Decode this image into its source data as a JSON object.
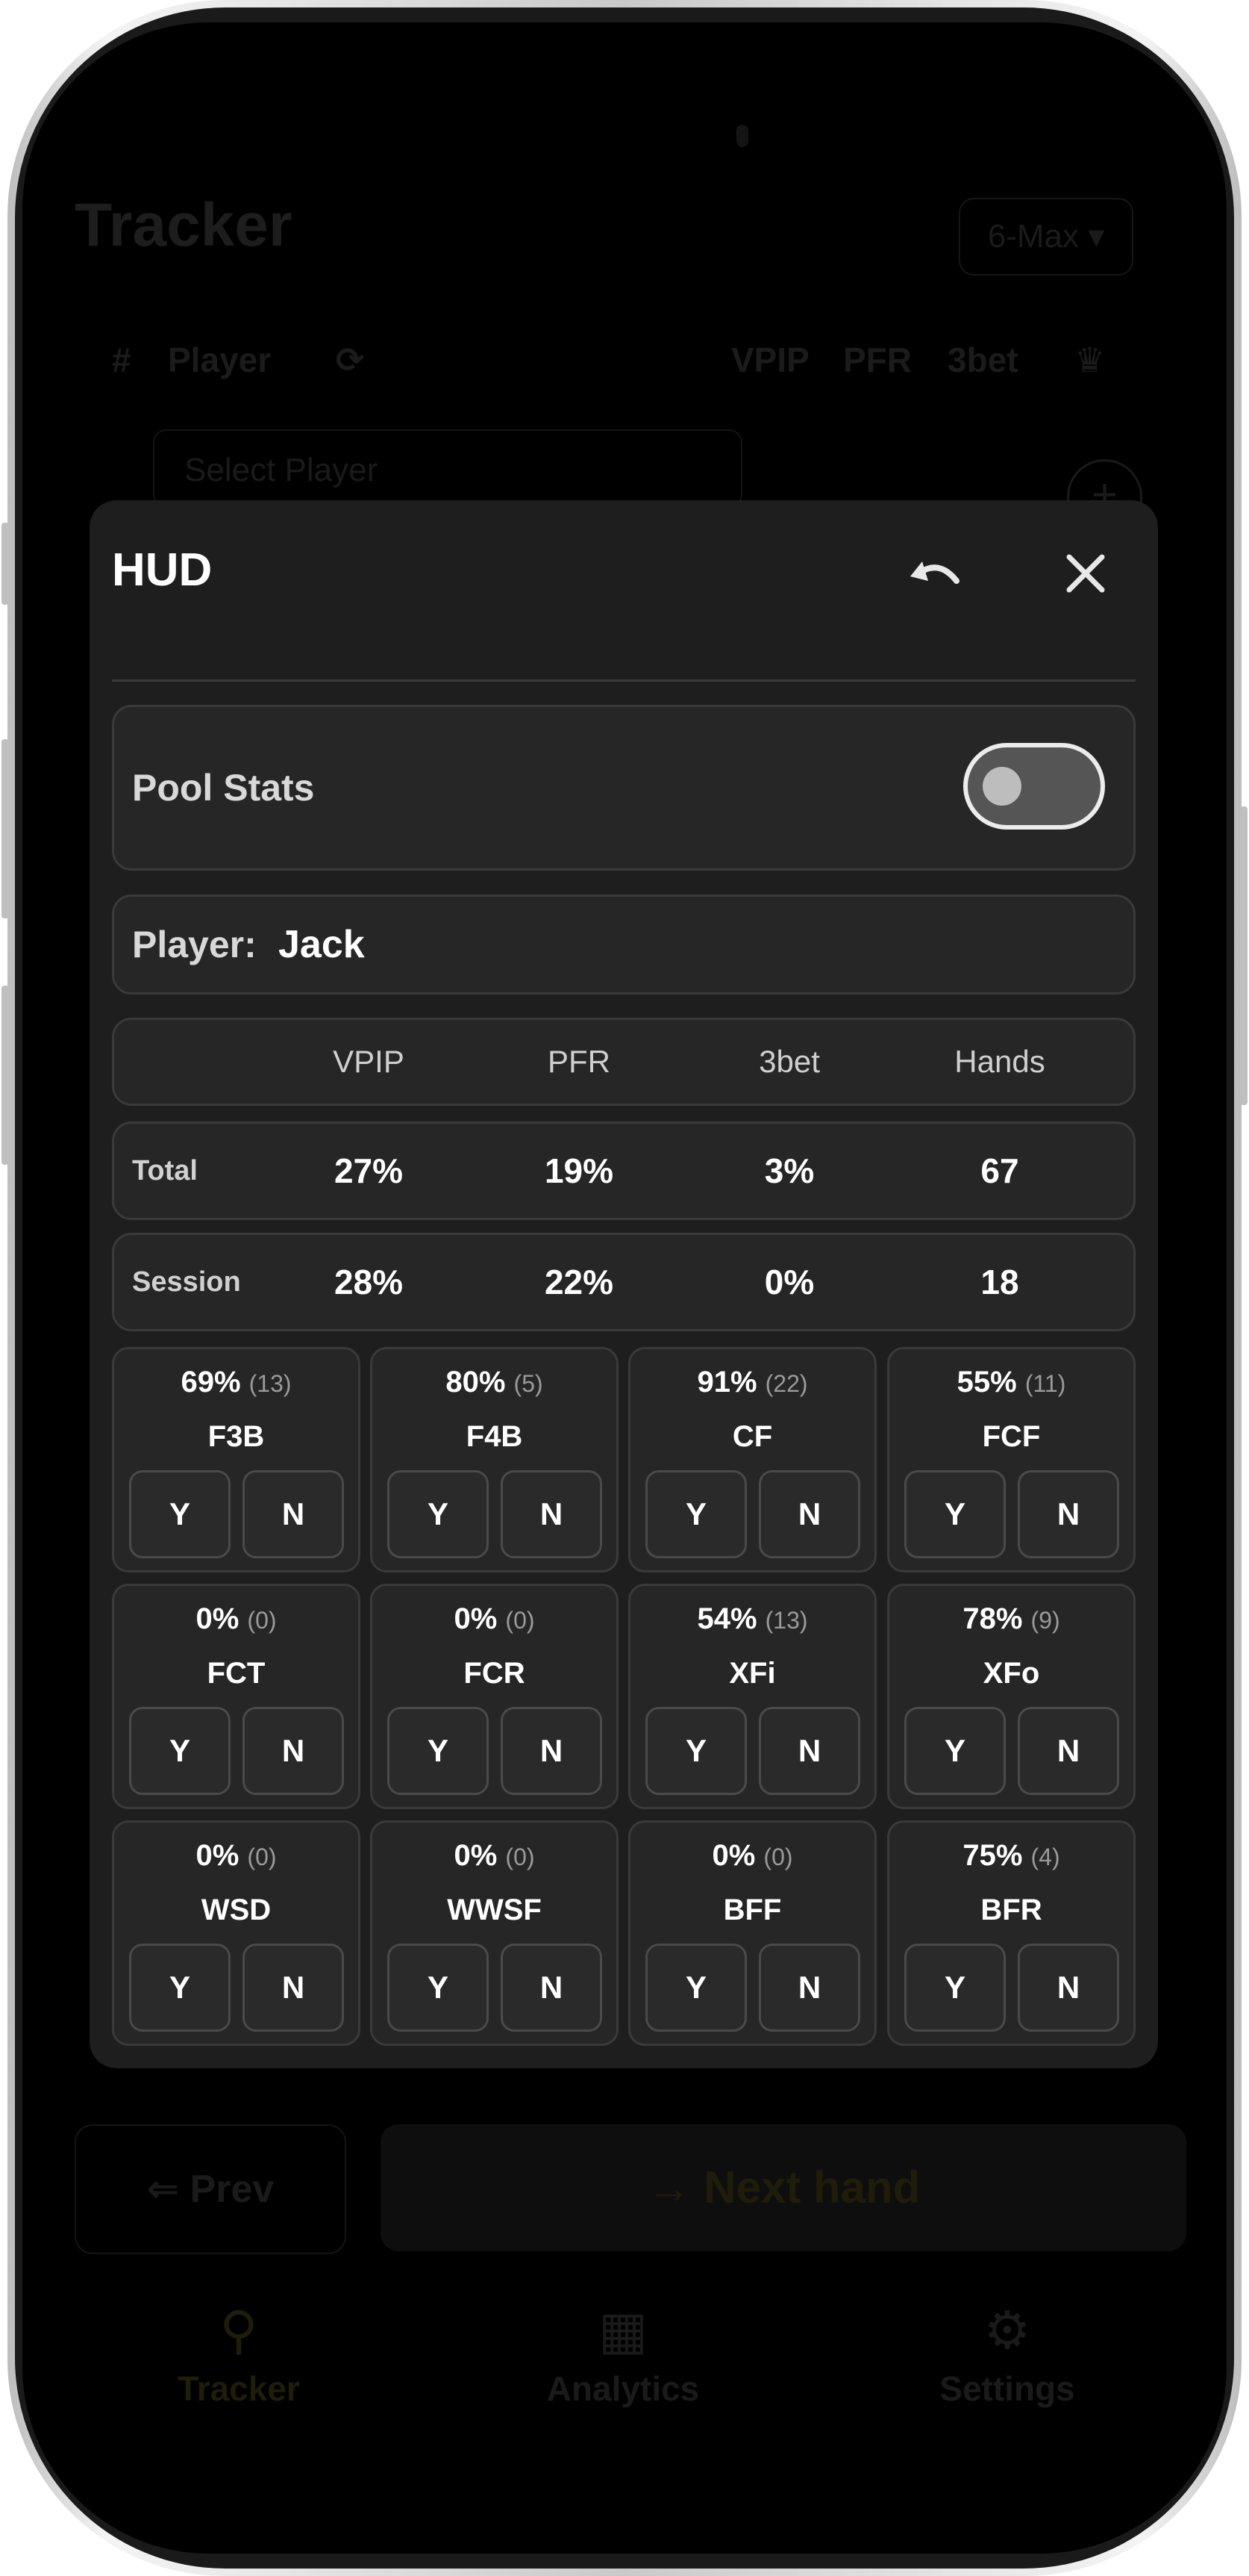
{
  "background": {
    "title": "Tracker",
    "mode_select": "6-Max ▾",
    "headers": [
      "#",
      "Player",
      "⟳",
      "VPIP",
      "PFR",
      "3bet",
      "♛"
    ],
    "select_player_placeholder": "Select Player",
    "prev_button": "⇐ Prev",
    "next_button": "→ Next hand",
    "nav": [
      {
        "label": "Tracker",
        "icon": "person-add-icon"
      },
      {
        "label": "Analytics",
        "icon": "chart-icon"
      },
      {
        "label": "Settings",
        "icon": "gear-icon"
      }
    ]
  },
  "hud": {
    "title": "HUD",
    "pool_stats_label": "Pool Stats",
    "pool_stats_on": false,
    "player_label": "Player:",
    "player_name": "Jack",
    "columns": [
      "VPIP",
      "PFR",
      "3bet",
      "Hands"
    ],
    "rows": [
      {
        "label": "Total",
        "values": [
          "27%",
          "19%",
          "3%",
          "67"
        ]
      },
      {
        "label": "Session",
        "values": [
          "28%",
          "22%",
          "0%",
          "18"
        ]
      }
    ],
    "yes_label": "Y",
    "no_label": "N",
    "tiles": [
      {
        "pct": "69%",
        "count": "(13)",
        "name": "F3B"
      },
      {
        "pct": "80%",
        "count": "(5)",
        "name": "F4B"
      },
      {
        "pct": "91%",
        "count": "(22)",
        "name": "CF"
      },
      {
        "pct": "55%",
        "count": "(11)",
        "name": "FCF"
      },
      {
        "pct": "0%",
        "count": "(0)",
        "name": "FCT"
      },
      {
        "pct": "0%",
        "count": "(0)",
        "name": "FCR"
      },
      {
        "pct": "54%",
        "count": "(13)",
        "name": "XFi"
      },
      {
        "pct": "78%",
        "count": "(9)",
        "name": "XFo"
      },
      {
        "pct": "0%",
        "count": "(0)",
        "name": "WSD"
      },
      {
        "pct": "0%",
        "count": "(0)",
        "name": "WWSF"
      },
      {
        "pct": "0%",
        "count": "(0)",
        "name": "BFF"
      },
      {
        "pct": "75%",
        "count": "(4)",
        "name": "BFR"
      }
    ]
  }
}
